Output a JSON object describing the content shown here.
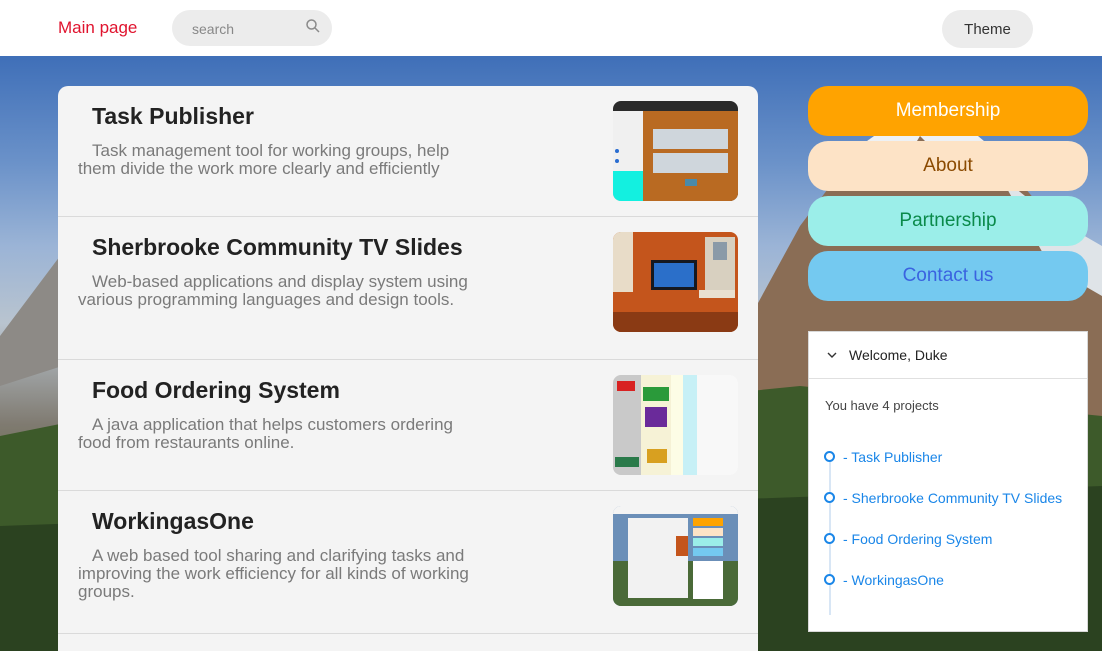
{
  "header": {
    "main_link": "Main page",
    "search_placeholder": "search",
    "theme_label": "Theme"
  },
  "projects": [
    {
      "title": "Task Publisher",
      "description": "Task management tool for working groups, help them divide the work more clearly and efficiently"
    },
    {
      "title": "Sherbrooke Community TV Slides",
      "description": "Web-based applications and display system using various programming languages and design tools."
    },
    {
      "title": "Food Ordering System",
      "description": "A java application that helps customers ordering food from restaurants online."
    },
    {
      "title": "WorkingasOne",
      "description": "A web based tool sharing and clarifying tasks and improving the work efficiency for all kinds of working groups."
    }
  ],
  "menu": [
    {
      "label": "Membership",
      "bg": "#ffa300",
      "color": "#ffffff"
    },
    {
      "label": "About",
      "bg": "#fde3c6",
      "color": "#8b4a00"
    },
    {
      "label": "Partnership",
      "bg": "#9beee9",
      "color": "#0a8a4a"
    },
    {
      "label": "Contact us",
      "bg": "#74c9f0",
      "color": "#3a63e0"
    }
  ],
  "welcome": {
    "greeting": "Welcome, Duke",
    "project_count_text": "You have 4 projects",
    "links": [
      "- Task Publisher",
      "- Sherbrooke Community TV Slides",
      "- Food Ordering System",
      "- WorkingasOne"
    ]
  },
  "colors": {
    "main_link": "#e0132e",
    "link_blue": "#1a86e8"
  },
  "icons": {
    "search": "magnifier-icon",
    "collapse": "chevron-down-icon"
  }
}
